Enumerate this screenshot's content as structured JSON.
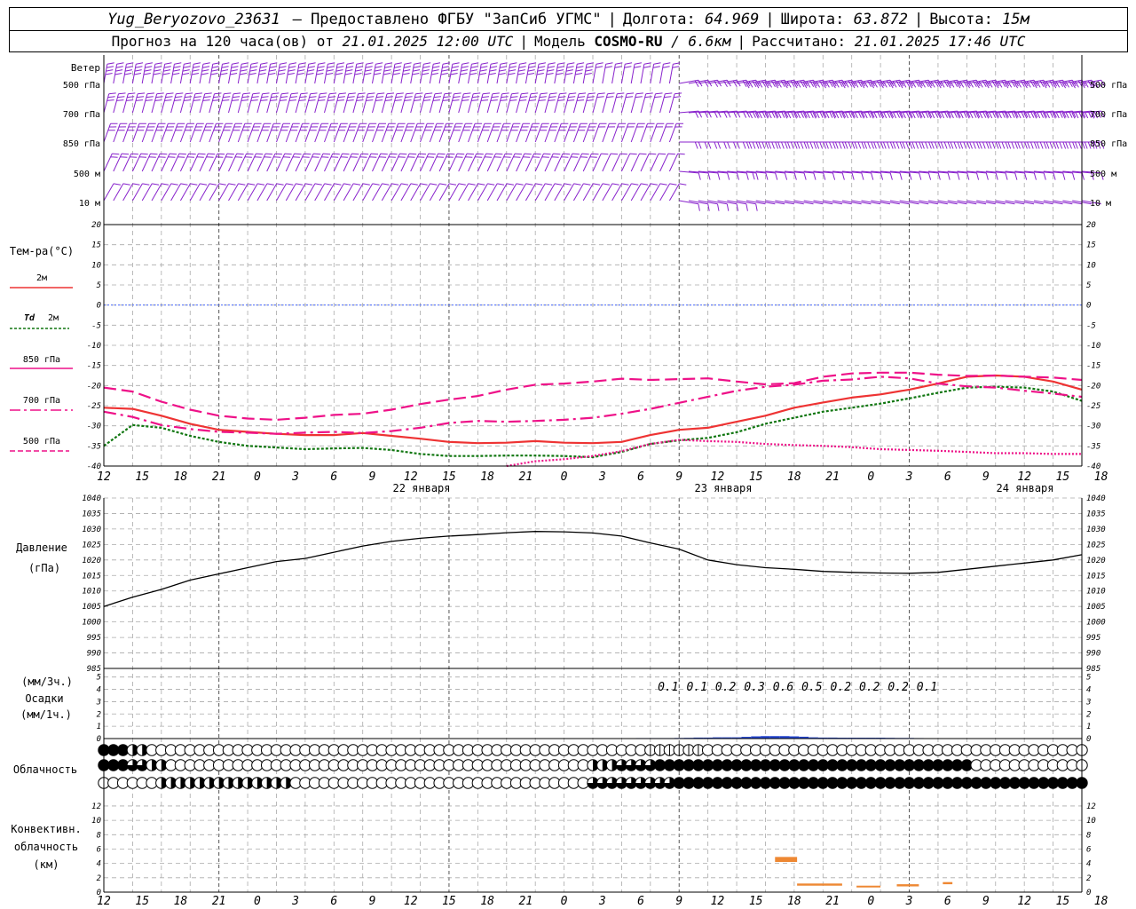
{
  "header": {
    "station": "Yug_Beryozovo_23631",
    "provider": "– Предоставлено ФГБУ \"ЗапСиб УГМС\"",
    "lon_label": "Долгота:",
    "lon_value": "64.969",
    "lat_label": "Широта:",
    "lat_value": "63.872",
    "alt_label": "Высота:",
    "alt_value": "15м",
    "forecast_label": "Прогноз на 120 часа(ов) от",
    "forecast_start": "21.01.2025 12:00 UTC",
    "model_label": "Модель",
    "model_name": "COSMO-RU",
    "model_res": "/ 6.6км",
    "calc_label": "Рассчитано:",
    "calc_time": "21.01.2025 17:46 UTC"
  },
  "labels": {
    "wind_title": "Ветер",
    "wind_levels": [
      "500 гПа",
      "700 гПа",
      "850 гПа",
      "500 м",
      "10  м"
    ],
    "temp_title": "Тем-ра(°C)",
    "legend_2m": "2м",
    "legend_td": "Td",
    "legend_td_2m": "2м",
    "legend_850": "850 гПа",
    "legend_700": "700 гПа",
    "legend_500": "500 гПа",
    "pressure_title": "Давление",
    "pressure_unit": "(гПа)",
    "precip_unit1": "(мм/3ч.)",
    "precip_title": "Осадки",
    "precip_unit2": "(мм/1ч.)",
    "cloud_title": "Облачность",
    "conv_title1": "Конвективн.",
    "conv_title2": "облачность",
    "conv_unit": "(км)",
    "dates": [
      "22 января",
      "23 января",
      "24 января"
    ]
  },
  "colors": {
    "t2m": "#ee3333",
    "td2m": "#117711",
    "t850": "#ee1188",
    "t700": "#ee1188",
    "t500": "#ee1188",
    "wind": "#8822cc",
    "precip": "#2244cc",
    "conv": "#ee8833",
    "zero_line": "#4466ff"
  },
  "chart_data": [
    {
      "type": "line",
      "name": "temperature",
      "xlabel": "",
      "ylabel": "Тем-ра(°C)",
      "x_hours": [
        0,
        3,
        6,
        9,
        12,
        15,
        18,
        21,
        24,
        27,
        30,
        33,
        36,
        39,
        42,
        45,
        48,
        51,
        54,
        57,
        60,
        63,
        66,
        69,
        72,
        75,
        78,
        81,
        84,
        87,
        90,
        93,
        96,
        99,
        102
      ],
      "x_ticks": [
        "12",
        "15",
        "18",
        "21",
        "0",
        "3",
        "6",
        "9",
        "12",
        "15",
        "18",
        "21",
        "0",
        "3",
        "6",
        "9",
        "12",
        "15",
        "18",
        "21",
        "0",
        "3",
        "6",
        "9",
        "12",
        "15",
        "18"
      ],
      "ylim": [
        -40,
        20
      ],
      "yticks": [
        20,
        15,
        10,
        5,
        0,
        -5,
        -10,
        -15,
        -20,
        -25,
        -30,
        -35,
        -40
      ],
      "series": [
        {
          "name": "2м",
          "style": "solid",
          "values": [
            -25.5,
            -25.8,
            -27.5,
            -29.5,
            -31,
            -31.5,
            -32,
            -32.3,
            -32.3,
            -31.8,
            -32.5,
            -33.2,
            -34,
            -34.3,
            -34.2,
            -33.8,
            -34.2,
            -34.3,
            -34,
            -32.3,
            -31,
            -30.5,
            -29,
            -27.5,
            -25.5,
            -24.2,
            -23,
            -22.2,
            -21,
            -19.5,
            -17.8,
            -17.5,
            -17.8,
            -19,
            -21
          ]
        },
        {
          "name": "Td 2м",
          "style": "dotted",
          "values": [
            -35,
            -29.8,
            -30.5,
            -32.5,
            -34,
            -35,
            -35.4,
            -35.8,
            -35.6,
            -35.5,
            -36,
            -37,
            -37.5,
            -37.5,
            -37.4,
            -37.4,
            -37.5,
            -37.8,
            -36.5,
            -34.5,
            -33.6,
            -33,
            -31.6,
            -29.5,
            -28,
            -26.5,
            -25.5,
            -24.5,
            -23.2,
            -21.8,
            -20.5,
            -20.3,
            -20.5,
            -21.5,
            -23.8
          ]
        },
        {
          "name": "850 гПа",
          "style": "dashed",
          "values": [
            -20.5,
            -21.5,
            -24,
            -26,
            -27.5,
            -28.2,
            -28.5,
            -28,
            -27.3,
            -27,
            -26,
            -24.6,
            -23.5,
            -22.6,
            -21,
            -19.8,
            -19.5,
            -19,
            -18.3,
            -18.6,
            -18.4,
            -18.2,
            -19,
            -19.7,
            -19.4,
            -17.8,
            -17,
            -16.8,
            -16.8,
            -17.3,
            -17.6,
            -17.5,
            -17.8,
            -18,
            -18.6
          ]
        },
        {
          "name": "700 гПа",
          "style": "dashdot",
          "values": [
            -26.5,
            -27.8,
            -29.8,
            -30.8,
            -31.5,
            -31.7,
            -32,
            -31.7,
            -31.5,
            -31.8,
            -31.3,
            -30.5,
            -29.3,
            -28.8,
            -29,
            -28.8,
            -28.5,
            -28,
            -27,
            -25.8,
            -24.3,
            -22.8,
            -21.3,
            -20.3,
            -19.8,
            -18.8,
            -18.5,
            -17.8,
            -18.2,
            -19.5,
            -20.2,
            -20.5,
            -21.3,
            -22,
            -22.8
          ]
        },
        {
          "name": "500 гПа",
          "style": "dotted",
          "values": [
            null,
            null,
            null,
            null,
            null,
            null,
            null,
            null,
            null,
            null,
            null,
            null,
            null,
            null,
            -40,
            -38.8,
            -38.3,
            -37.5,
            -36.3,
            -34.5,
            -33.5,
            -33.8,
            -34,
            -34.5,
            -34.8,
            -35,
            -35.3,
            -35.8,
            -36,
            -36.2,
            -36.5,
            -36.8,
            -36.8,
            -37,
            -37
          ]
        }
      ]
    },
    {
      "type": "line",
      "name": "pressure",
      "xlabel": "",
      "ylabel": "Давление (гПа)",
      "x_hours": [
        0,
        3,
        6,
        9,
        12,
        15,
        18,
        21,
        24,
        27,
        30,
        33,
        36,
        39,
        42,
        45,
        48,
        51,
        54,
        57,
        60,
        63,
        66,
        69,
        72,
        75,
        78,
        81,
        84,
        87,
        90,
        93,
        96,
        99,
        102
      ],
      "ylim": [
        985,
        1040
      ],
      "yticks": [
        1040,
        1035,
        1030,
        1025,
        1020,
        1015,
        1010,
        1005,
        1000,
        995,
        990,
        985
      ],
      "series": [
        {
          "name": "",
          "values": [
            1005,
            1008,
            1010.5,
            1013.5,
            1015.5,
            1017.5,
            1019.5,
            1020.5,
            1022.5,
            1024.5,
            1026,
            1027,
            1027.7,
            1028.2,
            1028.8,
            1029.2,
            1029.1,
            1028.7,
            1027.7,
            1025.5,
            1023.5,
            1020,
            1018.5,
            1017.5,
            1017,
            1016.3,
            1016,
            1015.8,
            1015.7,
            1016,
            1017,
            1018,
            1019,
            1020,
            1021.7
          ]
        }
      ]
    },
    {
      "type": "bar",
      "name": "precipitation",
      "xlabel": "",
      "ylabel": "Осадки",
      "ylim": [
        0,
        5
      ],
      "yticks": [
        5,
        4,
        3,
        2,
        1,
        0
      ],
      "totals_3h": [
        "0.1",
        "0.1",
        "0.2",
        "0.3",
        "0.6",
        "0.5",
        "0.2",
        "0.2",
        "0.2",
        "0.1"
      ],
      "totals_3h_hours": [
        57,
        60,
        63,
        66,
        69,
        72,
        75,
        78,
        81,
        84
      ],
      "hourly_hours": [
        55,
        56,
        57,
        58,
        59,
        60,
        61,
        62,
        63,
        64,
        65,
        66,
        67,
        68,
        69,
        70,
        71,
        72,
        73,
        74,
        75,
        76,
        77,
        78,
        79,
        80,
        81,
        82,
        83,
        84,
        85,
        86,
        87
      ],
      "hourly_values": [
        0.03,
        0.04,
        0.04,
        0.04,
        0.04,
        0.05,
        0.06,
        0.08,
        0.08,
        0.1,
        0.1,
        0.1,
        0.14,
        0.18,
        0.2,
        0.2,
        0.2,
        0.18,
        0.15,
        0.1,
        0.08,
        0.08,
        0.07,
        0.07,
        0.07,
        0.07,
        0.07,
        0.06,
        0.05,
        0.05,
        0.04,
        0.03,
        0.01
      ]
    },
    {
      "type": "bar",
      "name": "convective_cloud",
      "xlabel": "",
      "ylabel": "Конвективн. облачность (км)",
      "ylim": [
        0,
        13
      ],
      "yticks": [
        12,
        10,
        8,
        6,
        4,
        2,
        0
      ],
      "segments": [
        {
          "x_start_hour": 70,
          "x_end_hour": 72.3,
          "base_km": 4.2,
          "top_km": 4.9
        },
        {
          "x_start_hour": 72.3,
          "x_end_hour": 77,
          "base_km": 0.9,
          "top_km": 1.2
        },
        {
          "x_start_hour": 78.5,
          "x_end_hour": 81,
          "base_km": 0.7,
          "top_km": 0.9
        },
        {
          "x_start_hour": 82.7,
          "x_end_hour": 85,
          "base_km": 0.8,
          "top_km": 1.1
        },
        {
          "x_start_hour": 87.5,
          "x_end_hour": 88.5,
          "base_km": 1.1,
          "top_km": 1.4
        }
      ]
    }
  ]
}
